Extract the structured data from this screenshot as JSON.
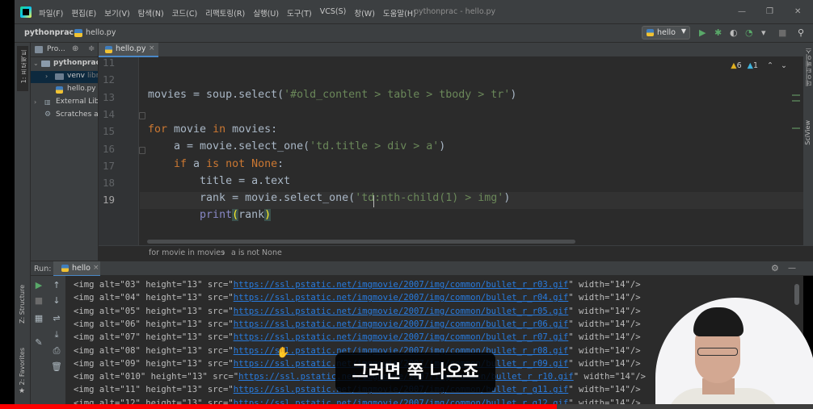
{
  "window": {
    "menu": [
      "파일(F)",
      "편집(E)",
      "보기(V)",
      "탐색(N)",
      "코드(C)",
      "리팩토링(R)",
      "실행(U)",
      "도구(T)",
      "VCS(S)",
      "창(W)",
      "도움말(H)"
    ],
    "title": "pythonprac - hello.py",
    "minimize": "—",
    "restore": "❐",
    "close": "✕"
  },
  "navbar": {
    "project": "pythonprac",
    "file": "hello.py",
    "run_config": "hello",
    "run_config_arrow": "▼"
  },
  "left_stripe": {
    "project_label": "1: 프로젝트",
    "structure_label": "Z: Structure",
    "favorites_label": "2: Favorites"
  },
  "right_stripe": {
    "database_label": "데이터베이스",
    "sciview_label": "SciView"
  },
  "project_panel": {
    "header": "Pro...",
    "tree": [
      {
        "label": "pythonprac",
        "extra": ""
      },
      {
        "label": "venv",
        "extra": "libr"
      },
      {
        "label": "hello.py",
        "extra": ""
      },
      {
        "label": "External Libr",
        "extra": ""
      },
      {
        "label": "Scratches an",
        "extra": ""
      }
    ]
  },
  "editor": {
    "tab": "hello.py",
    "tab_close": "×",
    "inspections": {
      "warnings": "6",
      "weak": "1"
    },
    "line_numbers": [
      "11",
      "12",
      "13",
      "14",
      "15",
      "16",
      "17",
      "18",
      "19"
    ],
    "lines": [
      {
        "parts": []
      },
      {
        "parts": [
          {
            "t": "movies = soup.select(",
            "c": ""
          },
          {
            "t": "'#old_content > table > tbody > tr'",
            "c": "str"
          },
          {
            "t": ")",
            "c": ""
          }
        ]
      },
      {
        "parts": []
      },
      {
        "parts": [
          {
            "t": "for",
            "c": "kw"
          },
          {
            "t": " movie ",
            "c": ""
          },
          {
            "t": "in",
            "c": "kw"
          },
          {
            "t": " movies:",
            "c": ""
          }
        ]
      },
      {
        "parts": [
          {
            "t": "    a = movie.select_one(",
            "c": ""
          },
          {
            "t": "'td.title > div > a'",
            "c": "str"
          },
          {
            "t": ")",
            "c": ""
          }
        ]
      },
      {
        "parts": [
          {
            "t": "    ",
            "c": ""
          },
          {
            "t": "if",
            "c": "kw"
          },
          {
            "t": " a ",
            "c": ""
          },
          {
            "t": "is not None",
            "c": "kw"
          },
          {
            "t": ":",
            "c": ""
          }
        ]
      },
      {
        "parts": [
          {
            "t": "        title = a.text",
            "c": ""
          }
        ]
      },
      {
        "parts": [
          {
            "t": "        rank = movie.select_one(",
            "c": ""
          },
          {
            "t": "'td:nth-child(1) > img'",
            "c": "str"
          },
          {
            "t": ")",
            "c": ""
          }
        ]
      },
      {
        "parts": [
          {
            "t": "        ",
            "c": ""
          },
          {
            "t": "print",
            "c": "bi"
          },
          {
            "t": "(",
            "c": "brace"
          },
          {
            "t": "rank",
            "c": ""
          },
          {
            "t": ")",
            "c": "brace"
          }
        ]
      }
    ],
    "breadcrumb": [
      "for movie in movies",
      "a is not None"
    ],
    "breadcrumb_sep": "›"
  },
  "run_panel": {
    "label": "Run:",
    "tab": "hello",
    "tab_close": "×",
    "console": [
      {
        "pre": "<img alt=\"03\" height=\"13\" src=\"",
        "url": "https://ssl.pstatic.net/imgmovie/2007/img/common/bullet_r_r03.gif",
        "post": "\" width=\"14\"/>"
      },
      {
        "pre": "<img alt=\"04\" height=\"13\" src=\"",
        "url": "https://ssl.pstatic.net/imgmovie/2007/img/common/bullet_r_r04.gif",
        "post": "\" width=\"14\"/>"
      },
      {
        "pre": "<img alt=\"05\" height=\"13\" src=\"",
        "url": "https://ssl.pstatic.net/imgmovie/2007/img/common/bullet_r_r05.gif",
        "post": "\" width=\"14\"/>"
      },
      {
        "pre": "<img alt=\"06\" height=\"13\" src=\"",
        "url": "https://ssl.pstatic.net/imgmovie/2007/img/common/bullet_r_r06.gif",
        "post": "\" width=\"14\"/>"
      },
      {
        "pre": "<img alt=\"07\" height=\"13\" src=\"",
        "url": "https://ssl.pstatic.net/imgmovie/2007/img/common/bullet_r_r07.gif",
        "post": "\" width=\"14\"/>"
      },
      {
        "pre": "<img alt=\"08\" height=\"13\" src=\"",
        "url": "https://ssl.pstatic.net/imgmovie/2007/img/common/bullet_r_r08.gif",
        "post": "\" width=\"14\"/>"
      },
      {
        "pre": "<img alt=\"09\" height=\"13\" src=\"",
        "url": "https://ssl.pstatic.net/imgmovie/2007/img/common/bullet_r_r09.gif",
        "post": "\" width=\"14\"/>"
      },
      {
        "pre": "<img alt=\"010\" height=\"13\" src=\"",
        "url": "https://ssl.pstatic.net/imgmovie/2007/img/common/bullet_r_r10.gif",
        "post": "\" width=\"14\"/>"
      },
      {
        "pre": "<img alt=\"11\" height=\"13\" src=\"",
        "url": "https://ssl.pstatic.net/imgmovie/2007/img/common/bullet_r_g11.gif",
        "post": "\" width=\"14\"/>"
      },
      {
        "pre": "<img alt=\"12\" height=\"13\" src=\"",
        "url": "https://ssl.pstatic.net/imgmovie/2007/img/common/bullet_r_g12.gif",
        "post": "\" width=\"14\"/>"
      }
    ]
  },
  "overlay": {
    "subtitle": "그러면 쭉 나오죠",
    "video_progress": 0.685
  },
  "colors": {
    "keyword": "#cc7832",
    "string": "#6a8759",
    "builtin": "#8888c6",
    "link": "#287bde",
    "progress": "#ff0000"
  }
}
